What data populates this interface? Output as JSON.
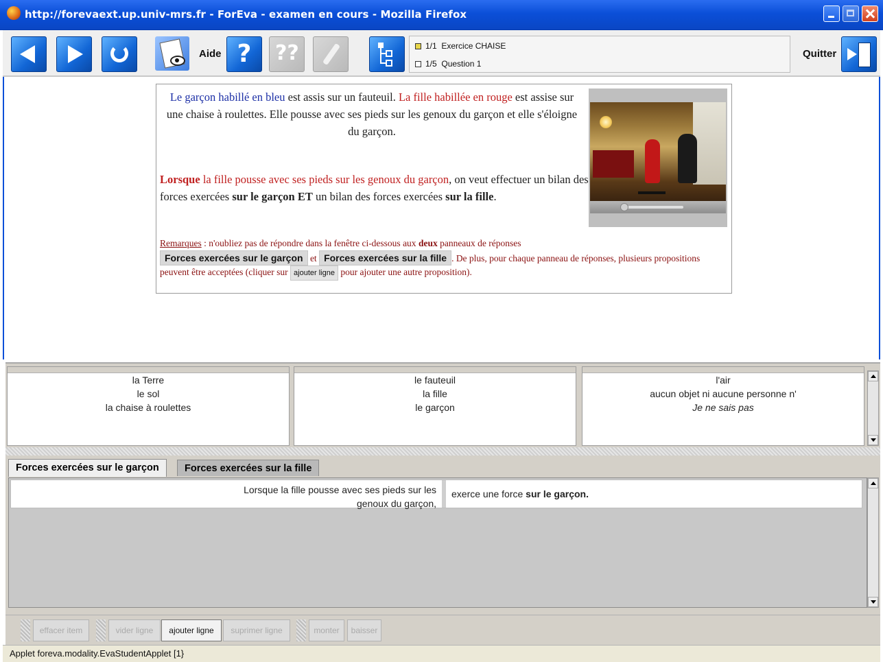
{
  "window": {
    "title": "http://forevaext.up.univ-mrs.fr - ForEva - examen en cours - Mozilla Firefox"
  },
  "toolbar": {
    "aide_label": "Aide",
    "quit_label": "Quitter",
    "exercise_counter": "1/1",
    "exercise_name": "Exercice CHAISE",
    "question_counter": "1/5",
    "question_name": "Question 1"
  },
  "exercise": {
    "intro_part1": "Le garçon habillé en bleu",
    "intro_part2": " est assis sur un fauteuil. ",
    "intro_part3": "La fille habillée en rouge",
    "intro_part4": " est assise sur une chaise à roulettes. Elle pousse avec ses pieds sur les genoux du garçon et elle s'éloigne du garçon.",
    "q_lorsque": "Lorsque",
    "q_red": " la fille pousse avec ses pieds sur les genoux du garçon",
    "q_mid": ", on veut effectuer un bilan des forces exercées ",
    "q_bold1": "sur le garçon ET",
    "q_mid2": " un bilan des forces exercées ",
    "q_bold2": "sur la fille",
    "q_end": ".",
    "rem_label": "Remarques",
    "rem_text1": " : n'oubliez pas de répondre dans la fenêtre ci-dessous aux ",
    "rem_deux": "deux",
    "rem_text2": " panneaux de réponses ",
    "rem_btn1": "Forces exercées sur le garçon",
    "rem_et": " et ",
    "rem_btn2": "Forces exercées sur la fille",
    "rem_text3": ". De plus, pour chaque panneau de réponses, plusieurs propositions peuvent être acceptées (cliquer sur ",
    "rem_btn3": "ajouter ligne",
    "rem_text4": " pour ajouter une autre proposition)."
  },
  "propositions": {
    "col1": [
      "la Terre",
      "le sol",
      "la chaise à roulettes"
    ],
    "col2": [
      "le fauteuil",
      "la fille",
      "le garçon"
    ],
    "col3": [
      "l'air",
      "aucun objet ni aucune personne n'",
      "Je ne sais pas"
    ]
  },
  "answer_panel": {
    "tab1": "Forces exercées sur le garçon",
    "tab2": "Forces exercées sur la fille",
    "row_left": "Lorsque la fille pousse avec ses pieds sur les genoux du garçon,",
    "row_right_plain": "exerce une force ",
    "row_right_bold": "sur le garçon."
  },
  "bottom_buttons": {
    "effacer": "effacer item",
    "vider": "vider ligne",
    "ajouter": "ajouter ligne",
    "supprimer": "suprimer ligne",
    "monter": "monter",
    "baisser": "baisser"
  },
  "status": {
    "text": "Applet foreva.modality.EvaStudentApplet [1}"
  },
  "icons": [
    "back-icon",
    "forward-icon",
    "refresh-icon",
    "view-document-icon",
    "help-icon",
    "hint-icon",
    "eraser-icon",
    "tree-icon",
    "quit-door-icon"
  ]
}
